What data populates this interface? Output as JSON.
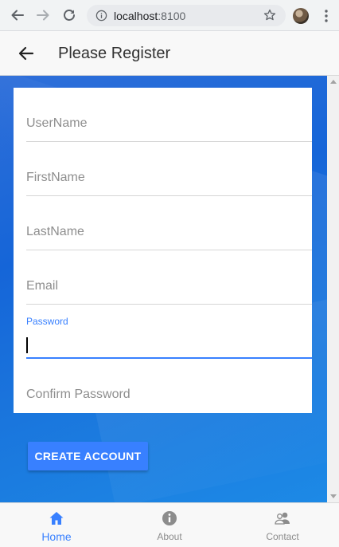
{
  "browser": {
    "url_host": "localhost",
    "url_port": ":8100"
  },
  "header": {
    "title": "Please Register"
  },
  "form": {
    "username_placeholder": "UserName",
    "firstname_placeholder": "FirstName",
    "lastname_placeholder": "LastName",
    "email_placeholder": "Email",
    "password_label": "Password",
    "password_value": "",
    "confirm_password_placeholder": "Confirm Password",
    "submit_label": "CREATE ACCOUNT"
  },
  "tabs": [
    {
      "label": "Home",
      "icon": "home-icon",
      "selected": true
    },
    {
      "label": "About",
      "icon": "info-icon",
      "selected": false
    },
    {
      "label": "Contact",
      "icon": "people-icon",
      "selected": false
    }
  ],
  "colors": {
    "accent": "#3880ff",
    "background": "#1565d8"
  }
}
